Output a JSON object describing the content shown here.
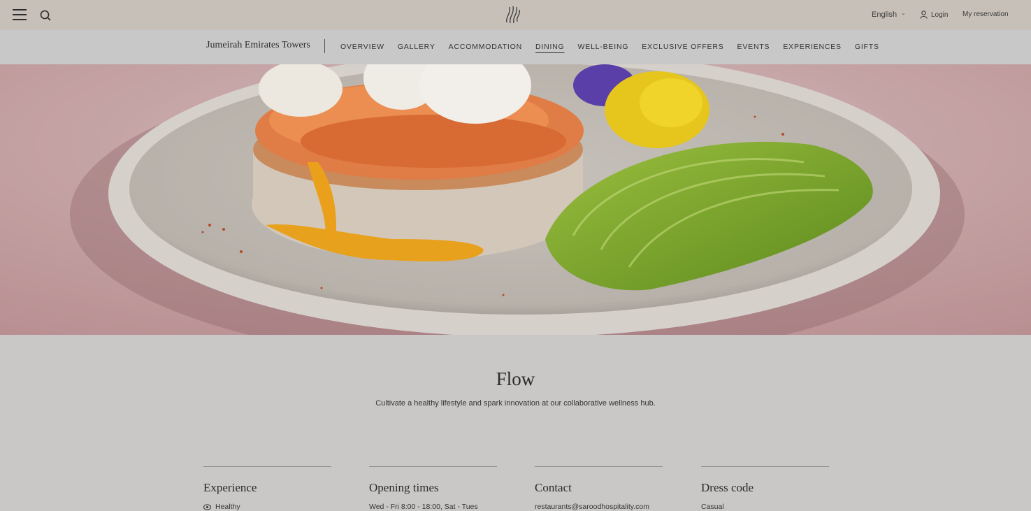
{
  "header": {
    "language": "English",
    "login_label": "Login",
    "reservation_label": "My reservation",
    "icons": [
      "menu-icon",
      "search-icon",
      "jumeirah-logo-icon",
      "chevron-down-icon",
      "user-icon"
    ]
  },
  "subnav": {
    "brand": "Jumeirah Emirates Towers",
    "links": [
      "OVERVIEW",
      "GALLERY",
      "ACCOMMODATION",
      "DINING",
      "WELL-BEING",
      "EXCLUSIVE OFFERS",
      "EVENTS",
      "EXPERIENCES",
      "GIFTS"
    ],
    "active": "DINING"
  },
  "restaurant": {
    "name": "Flow",
    "tagline": "Cultivate a healthy lifestyle and spark innovation at our collaborative wellness hub."
  },
  "details": [
    {
      "heading": "Experience",
      "value": "Healthy",
      "icon": "leaf-icon"
    },
    {
      "heading": "Opening times",
      "value": "Wed - Fri 8:00 - 18:00, Sat - Tues"
    },
    {
      "heading": "Contact",
      "value": "restaurants@saroodhospitality.com"
    },
    {
      "heading": "Dress code",
      "value": "Casual"
    }
  ]
}
